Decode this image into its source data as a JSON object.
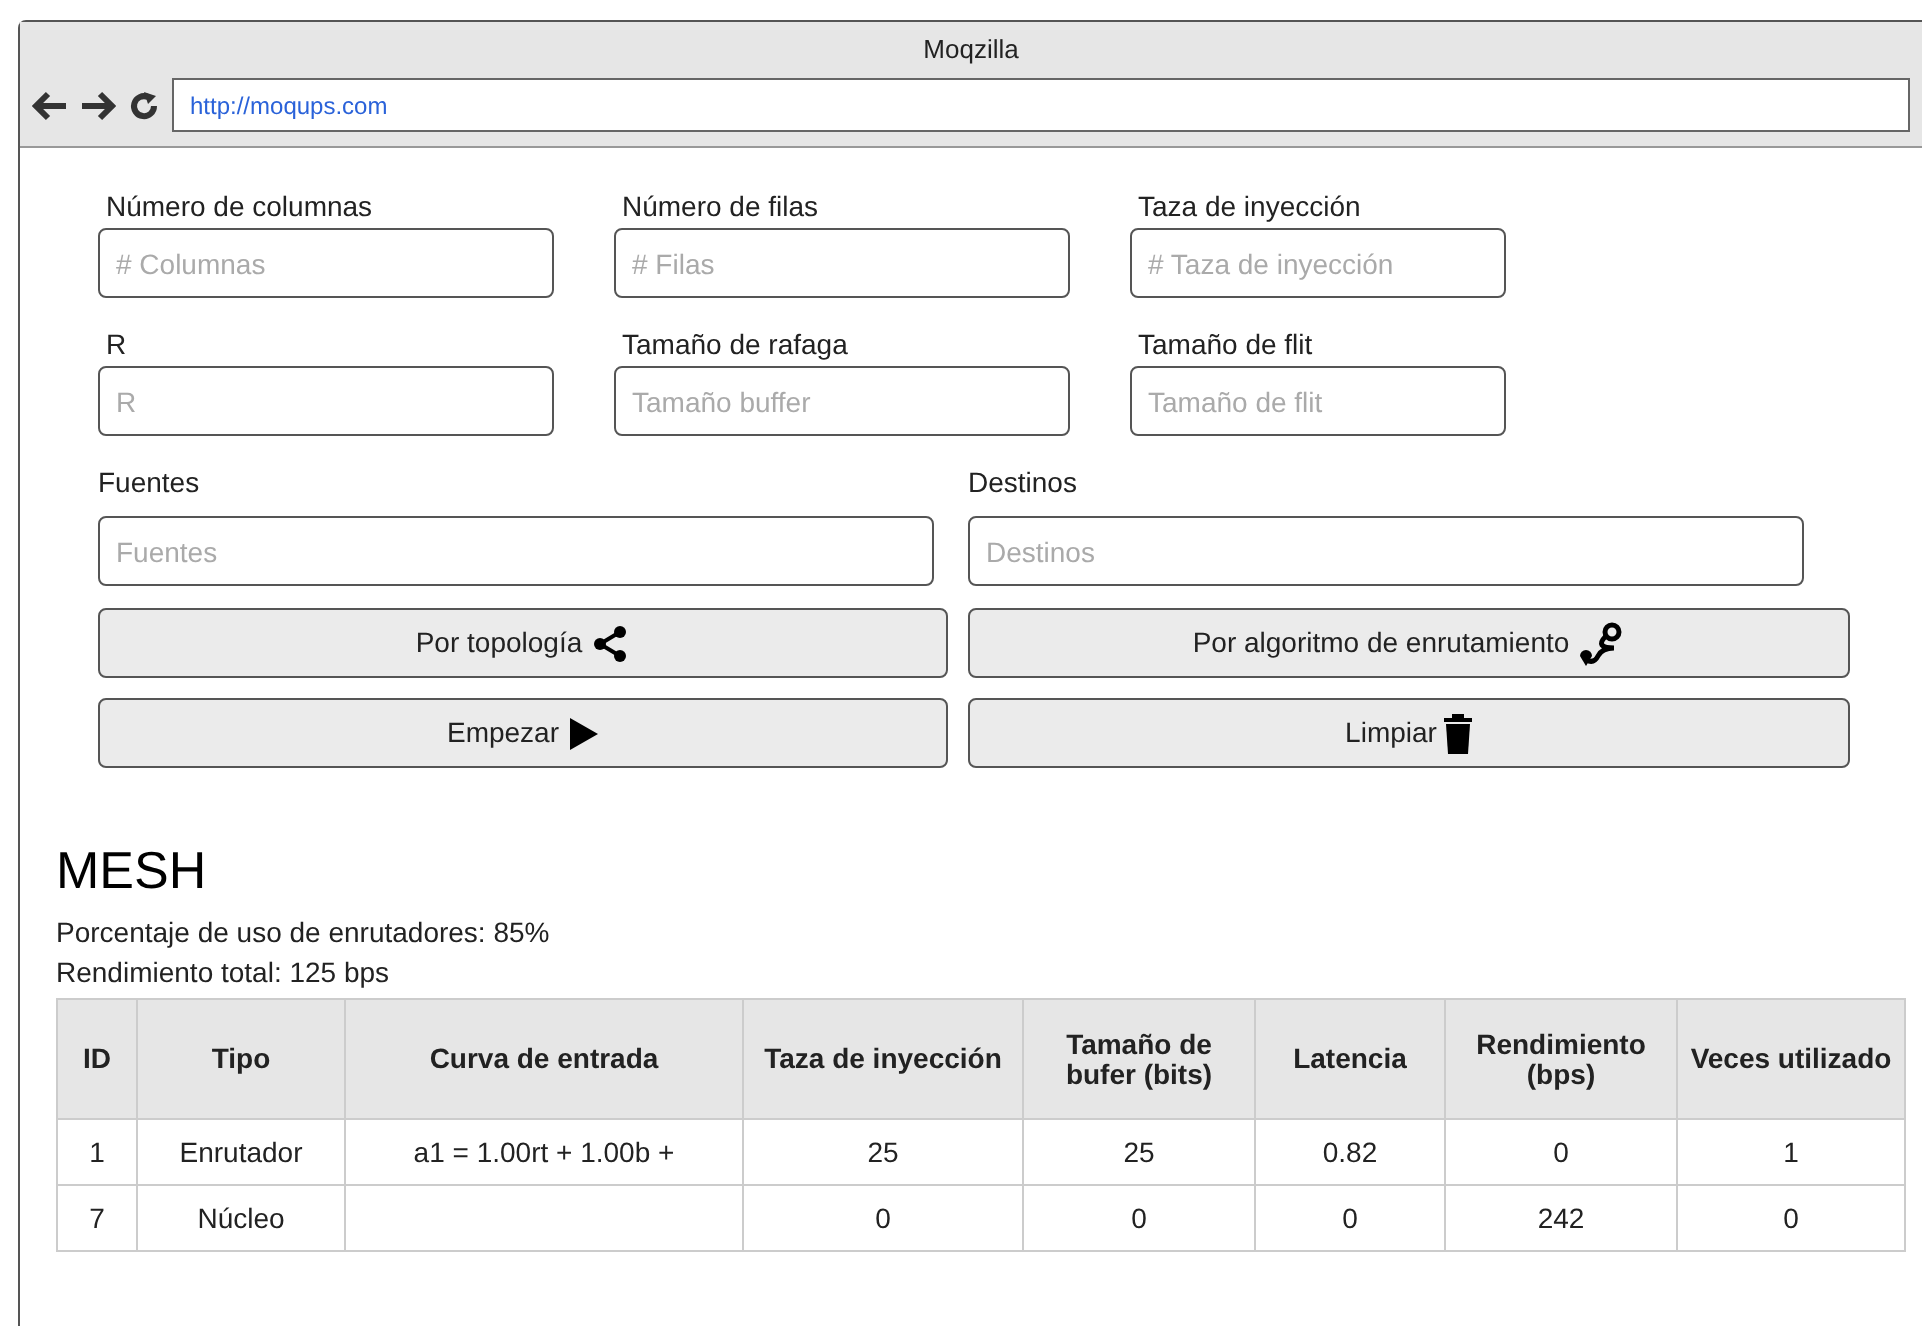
{
  "window": {
    "title": "Moqzilla",
    "url": "http://moqups.com"
  },
  "field_rows": [
    {
      "fields": [
        {
          "label": "Número de columnas",
          "placeholder": "# Columnas"
        },
        {
          "label": "Número de filas",
          "placeholder": "# Filas"
        },
        {
          "label": "Taza de inyección",
          "placeholder": "# Taza de inyección"
        }
      ]
    },
    {
      "fields": [
        {
          "label": "R",
          "placeholder": "R"
        },
        {
          "label": "Tamaño de rafaga",
          "placeholder": "Tamaño buffer"
        },
        {
          "label": "Tamaño de flit",
          "placeholder": "Tamaño de flit"
        }
      ]
    },
    {
      "fields": [
        {
          "label": "Fuentes",
          "placeholder": "Fuentes"
        },
        {
          "label": "Destinos",
          "placeholder": "Destinos"
        }
      ]
    }
  ],
  "buttons": [
    {
      "label": "Por topología"
    },
    {
      "label": "Por algoritmo de enrutamiento"
    },
    {
      "label": "Empezar"
    },
    {
      "label": "Limpiar"
    }
  ],
  "result": {
    "title": "MESH",
    "stats": [
      "Porcentaje de uso de enrutadores: 85%",
      "Rendimiento total: 125 bps"
    ]
  },
  "table": {
    "columns": [
      "ID",
      "Tipo",
      "Curva de entrada",
      "Taza de inyección",
      "Tamaño de bufer (bits)",
      "Latencia",
      "Rendimiento (bps)",
      "Veces utilizado"
    ],
    "rows": [
      [
        "1",
        "Enrutador",
        "a1 = 1.00rt + 1.00b +",
        "25",
        "25",
        "0.82",
        "0",
        "1"
      ],
      [
        "7",
        "Núcleo",
        "",
        "0",
        "0",
        "0",
        "242",
        "0"
      ]
    ]
  }
}
